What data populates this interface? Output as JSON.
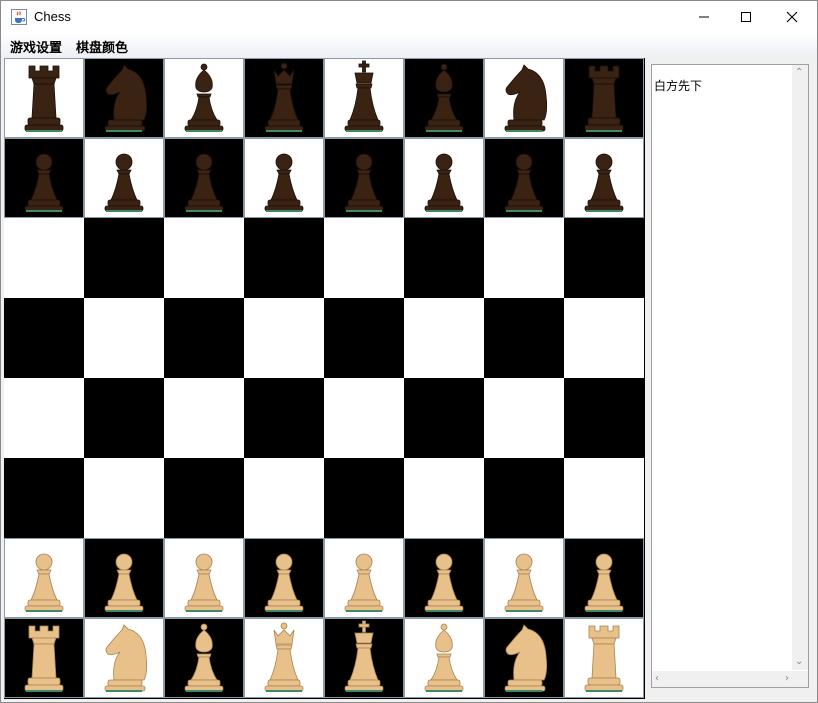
{
  "window": {
    "title": "Chess",
    "icon": "java-cup-icon"
  },
  "menubar": {
    "items": [
      {
        "label": "游戏设置"
      },
      {
        "label": "棋盘颜色"
      }
    ]
  },
  "board": {
    "light_color": "#ffffff",
    "dark_color": "#000000",
    "black_piece_color": "#3b2314",
    "white_piece_color": "#e8c08a",
    "rows": [
      [
        "black-rook",
        "black-knight",
        "black-bishop",
        "black-queen",
        "black-king",
        "black-bishop",
        "black-knight",
        "black-rook"
      ],
      [
        "black-pawn",
        "black-pawn",
        "black-pawn",
        "black-pawn",
        "black-pawn",
        "black-pawn",
        "black-pawn",
        "black-pawn"
      ],
      [
        "",
        "",
        "",
        "",
        "",
        "",
        "",
        ""
      ],
      [
        "",
        "",
        "",
        "",
        "",
        "",
        "",
        ""
      ],
      [
        "",
        "",
        "",
        "",
        "",
        "",
        "",
        ""
      ],
      [
        "",
        "",
        "",
        "",
        "",
        "",
        "",
        ""
      ],
      [
        "white-pawn",
        "white-pawn",
        "white-pawn",
        "white-pawn",
        "white-pawn",
        "white-pawn",
        "white-pawn",
        "white-pawn"
      ],
      [
        "white-rook",
        "white-knight",
        "white-bishop",
        "white-queen",
        "white-king",
        "white-bishop",
        "white-knight",
        "white-rook"
      ]
    ]
  },
  "side_panel": {
    "status_text": "白方先下"
  }
}
